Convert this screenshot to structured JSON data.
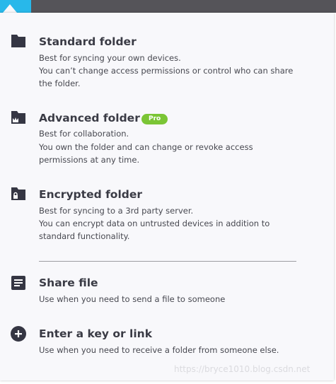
{
  "menu": {
    "items": [
      {
        "icon": "folder-icon",
        "title": "Standard folder",
        "lines": [
          "Best for syncing your own devices.",
          "You can’t change access permissions or control who can share",
          "the folder."
        ]
      },
      {
        "icon": "crown-folder-icon",
        "title": "Advanced folder",
        "badge": "Pro",
        "lines": [
          "Best for collaboration.",
          "You own the folder and can change or revoke access",
          "permissions at any time."
        ]
      },
      {
        "icon": "lock-folder-icon",
        "title": "Encrypted folder",
        "lines": [
          "Best for syncing to a 3rd party server.",
          "You can encrypt data on untrusted devices in addition to",
          "standard functionality."
        ]
      },
      {
        "icon": "file-icon",
        "title": "Share file",
        "lines": [
          "Use when you need to send a file to someone"
        ]
      },
      {
        "icon": "plus-circle-icon",
        "title": "Enter a key or link",
        "lines": [
          "Use when you need to receive a folder from someone else."
        ]
      }
    ]
  },
  "watermark": "https://bryce1010.blog.csdn.net",
  "colors": {
    "topbar": "#555459",
    "accent_tab": "#28b8ea",
    "panel": "#f8f8fb",
    "title_text": "#3a3b45",
    "body_text": "#474850",
    "pro_badge": "#7bc535",
    "icon": "#353643"
  }
}
